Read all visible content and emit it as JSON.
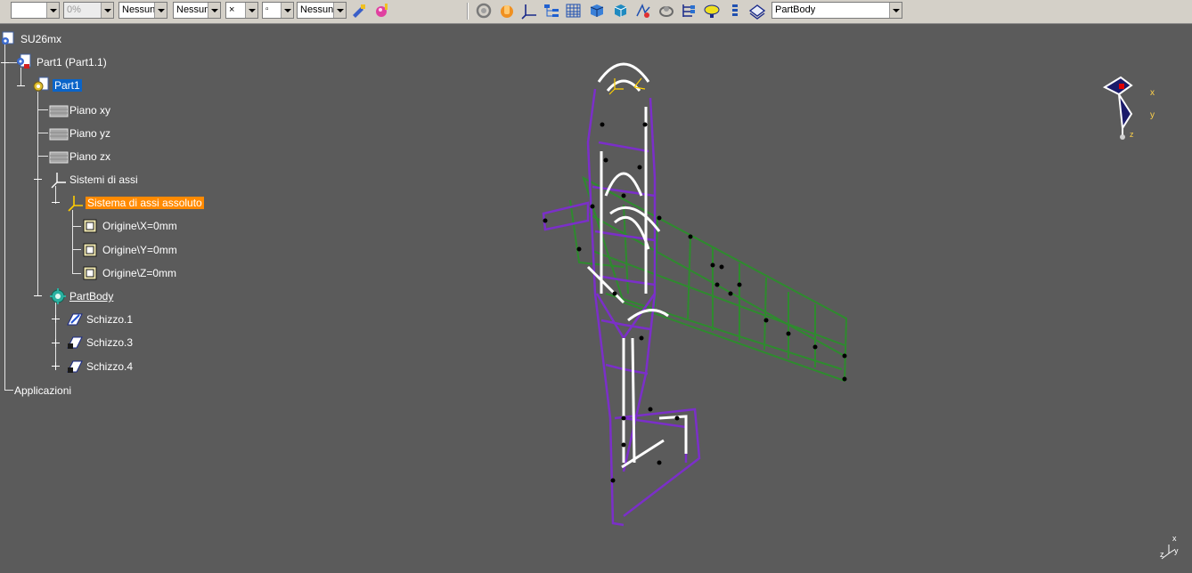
{
  "toolbar": {
    "combos": {
      "line_color_value": "",
      "transparency_value": "0%",
      "linetype_value": "Nessun",
      "thickness_value": "Nessun",
      "point_symbol_value": "×",
      "layer_value": "Nessunc",
      "body_selector_value": "PartBody"
    },
    "icons": [
      "painter-icon",
      "material-icon",
      "rotate-icon",
      "pan-hand-icon",
      "axis-system-icon",
      "grid-icon",
      "multi-grid-icon",
      "box-view-icon",
      "cube-view-icon",
      "analysis-icon",
      "flow-icon",
      "hierarchy-icon",
      "lamp-icon",
      "list-icon",
      "surface-icon"
    ]
  },
  "tree": {
    "root": "SU26mx",
    "part": "Part1 (Part1.1)",
    "partbody_root": "Part1",
    "planes": [
      "Piano xy",
      "Piano yz",
      "Piano zx"
    ],
    "axis_systems": "Sistemi di assi",
    "absolute_axis": "Sistema di assi assoluto",
    "origins": [
      "Origine\\X=0mm",
      "Origine\\Y=0mm",
      "Origine\\Z=0mm"
    ],
    "partbody": "PartBody",
    "sketches": [
      "Schizzo.1",
      "Schizzo.3",
      "Schizzo.4"
    ],
    "applications": "Applicazioni"
  },
  "compass": {
    "x_label": "x",
    "y_label": "y",
    "z_label": "z"
  },
  "mini_axis": {
    "x_label": "x",
    "y_label": "y",
    "z_label": "z"
  },
  "colors": {
    "background": "#5b5b5b",
    "tree_line": "#e6e6e6",
    "selection_blue": "#0a64c8",
    "selection_orange": "#ff8a00",
    "wire_green": "#2e8b2e",
    "wire_purple": "#7b2fc9",
    "wire_white": "#ffffff"
  }
}
